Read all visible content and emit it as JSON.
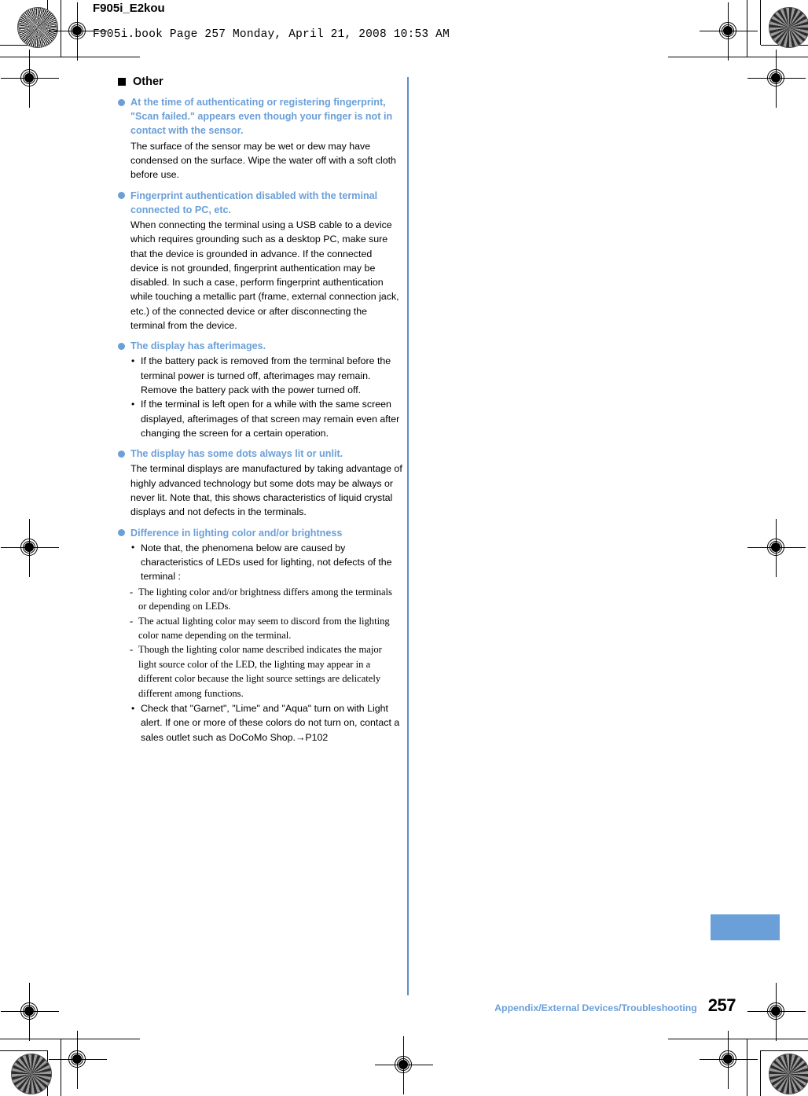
{
  "header": {
    "file_label": "F905i_E2kou",
    "book_line": "F905i.book  Page 257  Monday, April 21, 2008  10:53 AM"
  },
  "section": {
    "marker": "filled-square",
    "title": "Other"
  },
  "accent_color": "#6a9fd8",
  "rule_color": "#5b8fc9",
  "items": [
    {
      "heading": "At the time of authenticating or registering fingerprint, \"Scan failed.\" appears even though your finger is not in contact with the sensor.",
      "body": "The surface of the sensor may be wet or dew may have condensed on the surface. Wipe the water off with a soft cloth before use."
    },
    {
      "heading": "Fingerprint authentication disabled with the terminal connected to PC, etc.",
      "body": "When connecting the terminal using a USB cable to a device which requires grounding such as a desktop PC, make sure that the device is grounded in advance. If the connected device is not grounded, fingerprint authentication may be disabled. In such a case, perform fingerprint authentication while touching a metallic part (frame, external connection jack, etc.) of the connected device or after disconnecting the terminal from the device."
    },
    {
      "heading": "The display has afterimages.",
      "bullets": [
        "If the battery pack is removed from the terminal before the terminal power is turned off, afterimages may remain. Remove the battery pack with the power turned off.",
        "If the terminal is left open for a while with the same screen displayed, afterimages of that screen may remain even after changing the screen for a certain operation."
      ]
    },
    {
      "heading": "The display has some dots always lit or unlit.",
      "body": "The terminal displays are manufactured by taking advantage of highly advanced technology but some dots may be always or never lit. Note that, this shows characteristics of liquid crystal displays and not defects in the terminals."
    },
    {
      "heading": "Difference in lighting color and/or brightness",
      "bullets": [
        "Note that, the phenomena below are caused by characteristics of LEDs used for lighting, not defects of the terminal :",
        "Check that \"Garnet\", \"Lime\" and \"Aqua\" turn on with Light alert. If one or more of these colors do not turn on, contact a sales outlet such as DoCoMo Shop.→P102"
      ],
      "sub_dashes": [
        "The lighting color and/or brightness differs among the terminals or depending on LEDs.",
        "The actual lighting color may seem to discord from the lighting color name depending on the terminal.",
        "Though the lighting color name described indicates the major light source color of the LED, the lighting may appear in a different color because the light source settings are delicately different among functions."
      ]
    }
  ],
  "footer": {
    "breadcrumb": "Appendix/External Devices/Troubleshooting",
    "page_number": "257"
  }
}
